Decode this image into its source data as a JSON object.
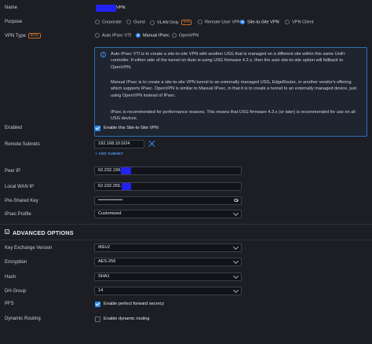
{
  "name": {
    "label": "Name",
    "value": "VPN"
  },
  "purpose": {
    "label": "Purpose",
    "options": [
      "Corporate",
      "Guest",
      "VLAN Only",
      "Remote User VPN",
      "Site-to-Site VPN",
      "VPN Client"
    ],
    "selected": "Site-to-Site VPN",
    "vlan_only_tag": "VPN"
  },
  "vpn_type": {
    "label": "VPN Type",
    "tag": "BETA",
    "options": [
      "Auto IPsec VTI",
      "Manual IPsec",
      "OpenVPN"
    ],
    "selected": "Manual IPsec"
  },
  "info": {
    "icon": "info-icon",
    "p1": "Auto IPsec VTI is to create a site-to-site VPN with another USG that is managed on a different site within this same UniFi controller. If either side of the tunnel on Auto is using USG firmware 4.2.x, then the auto site-to-site option will fallback to OpenVPN.",
    "p2": "Manual IPsec is to create a site-to-site VPN tunnel to an externally managed USG, EdgeRouter, or another vendor's offering which supports IPsec. OpenVPN is similar to Manual IPsec, in that it is to create a tunnel to an externally managed device, just using OpenVPN instead of IPsec.",
    "p3": "IPsec is recommended for performance reasons. This means that USG firmware 4.3.x (or later) is recommended for use on all USG devices."
  },
  "enabled": {
    "label": "Enabled",
    "checkbox_label": "Enable this Site-to-Site VPN",
    "checked": true
  },
  "remote_subnets": {
    "label": "Remote Subnets",
    "value": "192.168.10.0/24",
    "add_label": "+ ADD SUBNET"
  },
  "peer_ip": {
    "label": "Peer IP",
    "value": "62.232.199."
  },
  "local_wan_ip": {
    "label": "Local WAN IP",
    "value": "62.232.255."
  },
  "pre_shared_key": {
    "label": "Pre-Shared Key",
    "value": "••••••••••••••••"
  },
  "ipsec_profile": {
    "label": "IPsec Profile",
    "value": "Customized"
  },
  "advanced": {
    "title": "ADVANCED OPTIONS"
  },
  "key_exchange": {
    "label": "Key Exchange Version",
    "value": "IKEv2"
  },
  "encryption": {
    "label": "Encryption",
    "value": "AES-256"
  },
  "hash": {
    "label": "Hash",
    "value": "SHA1"
  },
  "dh_group": {
    "label": "DH Group",
    "value": "14"
  },
  "pfs": {
    "label": "PFS",
    "checkbox_label": "Enable perfect forward secrecy",
    "checked": true
  },
  "dynamic_routing": {
    "label": "Dynamic Routing",
    "checkbox_label": "Enable dynamic routing",
    "checked": false
  },
  "colors": {
    "background": "#1c1e24",
    "accent": "#2f8df2",
    "beta": "#f08a3a",
    "redaction": "#2222ee"
  }
}
